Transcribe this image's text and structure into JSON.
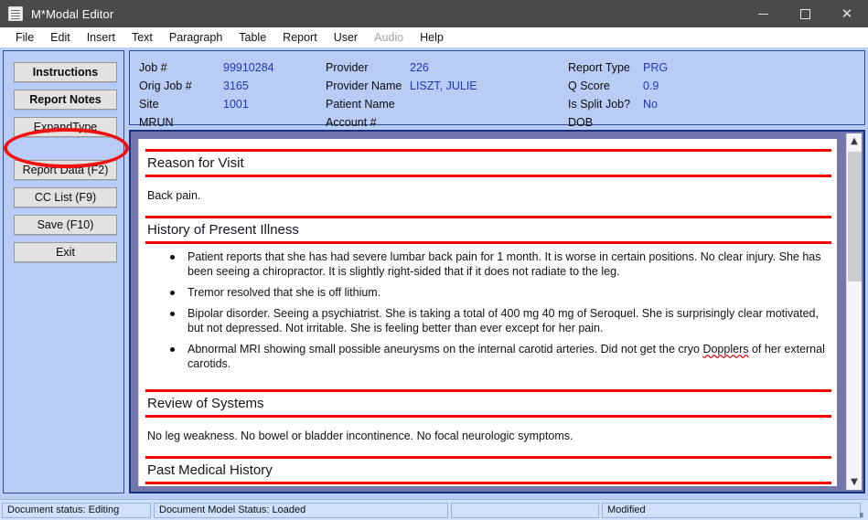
{
  "window": {
    "title": "M*Modal Editor",
    "icon": "document-icon",
    "controls": {
      "minimize": "minimize-icon",
      "maximize": "maximize-icon",
      "close": "close-icon"
    }
  },
  "menu": {
    "items": [
      {
        "label": "File",
        "disabled": false
      },
      {
        "label": "Edit",
        "disabled": false
      },
      {
        "label": "Insert",
        "disabled": false
      },
      {
        "label": "Text",
        "disabled": false
      },
      {
        "label": "Paragraph",
        "disabled": false
      },
      {
        "label": "Table",
        "disabled": false
      },
      {
        "label": "Report",
        "disabled": false
      },
      {
        "label": "User",
        "disabled": false
      },
      {
        "label": "Audio",
        "disabled": true
      },
      {
        "label": "Help",
        "disabled": false
      }
    ]
  },
  "sidebar": {
    "tabs": [
      {
        "label": "Instructions",
        "bold": true
      },
      {
        "label": "Report Notes",
        "bold": true
      },
      {
        "label": "ExpandType",
        "bold": false
      }
    ],
    "actions": [
      {
        "label": "Report Data (F2)"
      },
      {
        "label": "CC List (F9)"
      },
      {
        "label": "Save (F10)"
      },
      {
        "label": "Exit"
      }
    ],
    "annotation": {
      "target": "Report Notes",
      "shape": "ellipse",
      "color": "#f01010"
    }
  },
  "job_header": {
    "columns": [
      {
        "rows": [
          {
            "label": "Job #",
            "value": "99910284"
          },
          {
            "label": "Orig Job #",
            "value": "3165"
          },
          {
            "label": "Site",
            "value": "1001"
          },
          {
            "label": "MRUN",
            "value": ""
          }
        ]
      },
      {
        "rows": [
          {
            "label": "Provider",
            "value": "226"
          },
          {
            "label": "Provider Name",
            "value": "LISZT, JULIE"
          },
          {
            "label": "Patient Name",
            "value": ""
          },
          {
            "label": "Account #",
            "value": ""
          }
        ]
      },
      {
        "rows": [
          {
            "label": "Report Type",
            "value": "PRG"
          },
          {
            "label": "Q Score",
            "value": "0.9"
          },
          {
            "label": "Is Split Job?",
            "value": "No"
          },
          {
            "label": "DOB",
            "value": ""
          }
        ]
      }
    ]
  },
  "document": {
    "sections": {
      "reason_for_visit": {
        "title": "Reason for Visit",
        "body": "Back pain."
      },
      "history_of_present_illness": {
        "title": "History of Present Illness",
        "bullets": [
          "Patient reports that she has had severe lumbar back pain for 1 month.  It is worse in certain positions.  No clear injury.  She has been seeing a chiropractor.  It is slightly right-sided that if it does not radiate to the leg.",
          "Tremor resolved that she is off lithium.",
          "Bipolar disorder.  Seeing a psychiatrist.  She is taking a total of 400 mg 40 mg of Seroquel.  She is surprisingly clear motivated, but not depressed.  Not irritable.  She is feeling better than ever except for her pain."
        ],
        "bullet_4_part1": "Abnormal MRI showing small possible aneurysms on the internal carotid arteries.  Did not get the cryo ",
        "bullet_4_misspelled": "Dopplers",
        "bullet_4_part2": " of her external carotids."
      },
      "review_of_systems": {
        "title": "Review of Systems",
        "body": "No leg weakness.  No bowel or bladder incontinence.  No focal neurologic symptoms."
      },
      "past_medical_history": {
        "title": "Past Medical History"
      }
    },
    "scrollbar": {
      "up_icon": "chevron-up-icon",
      "down_icon": "chevron-down-icon"
    }
  },
  "status_bar": {
    "cells": [
      "Document status: Editing",
      "Document Model Status: Loaded",
      "",
      "Modified"
    ],
    "grip_icon": "resize-grip-icon"
  }
}
